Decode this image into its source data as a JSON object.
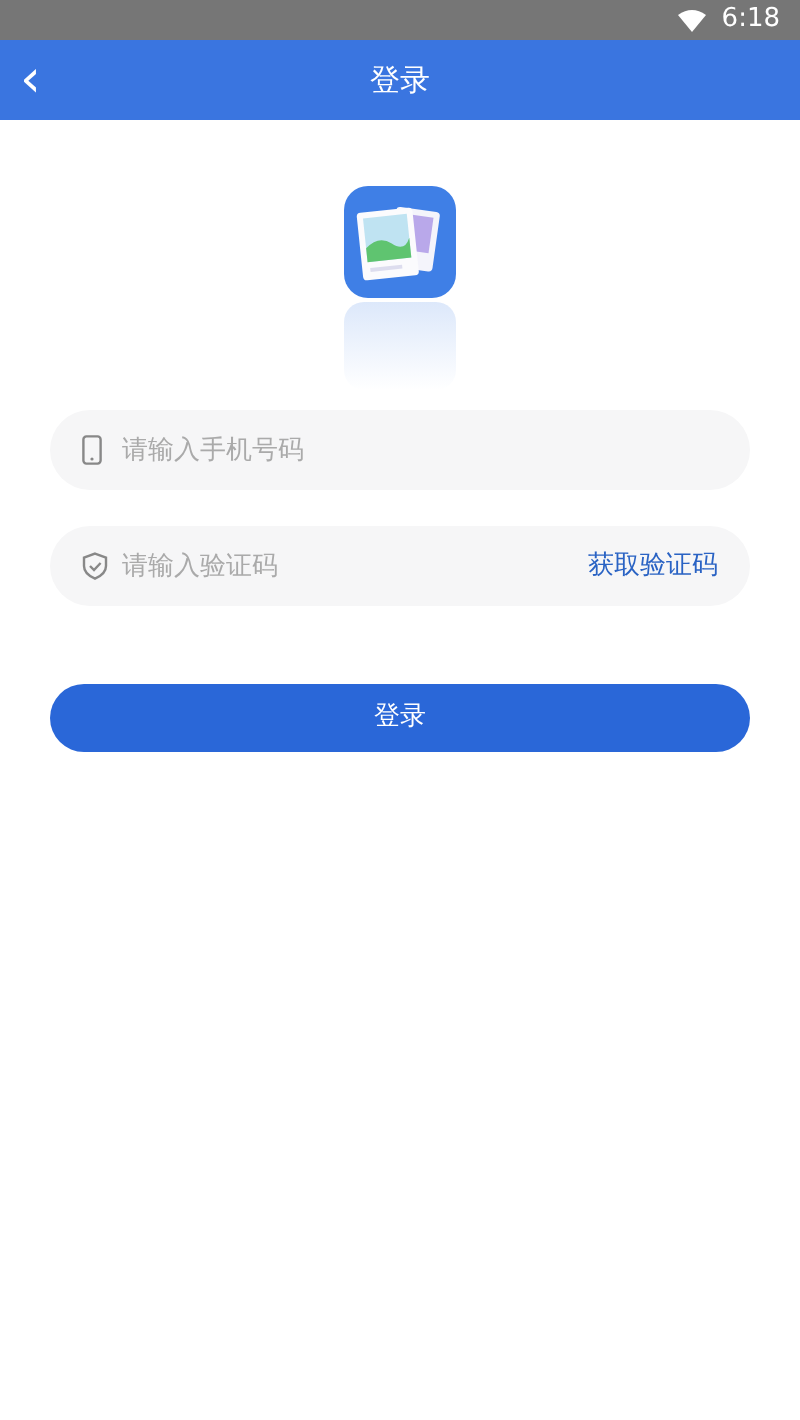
{
  "status_bar": {
    "time": "6:18"
  },
  "app_bar": {
    "back": "‹",
    "title": "登录"
  },
  "form": {
    "phone": {
      "placeholder": "请输入手机号码"
    },
    "code": {
      "placeholder": "请输入验证码",
      "action": "获取验证码"
    },
    "submit": "登录"
  }
}
